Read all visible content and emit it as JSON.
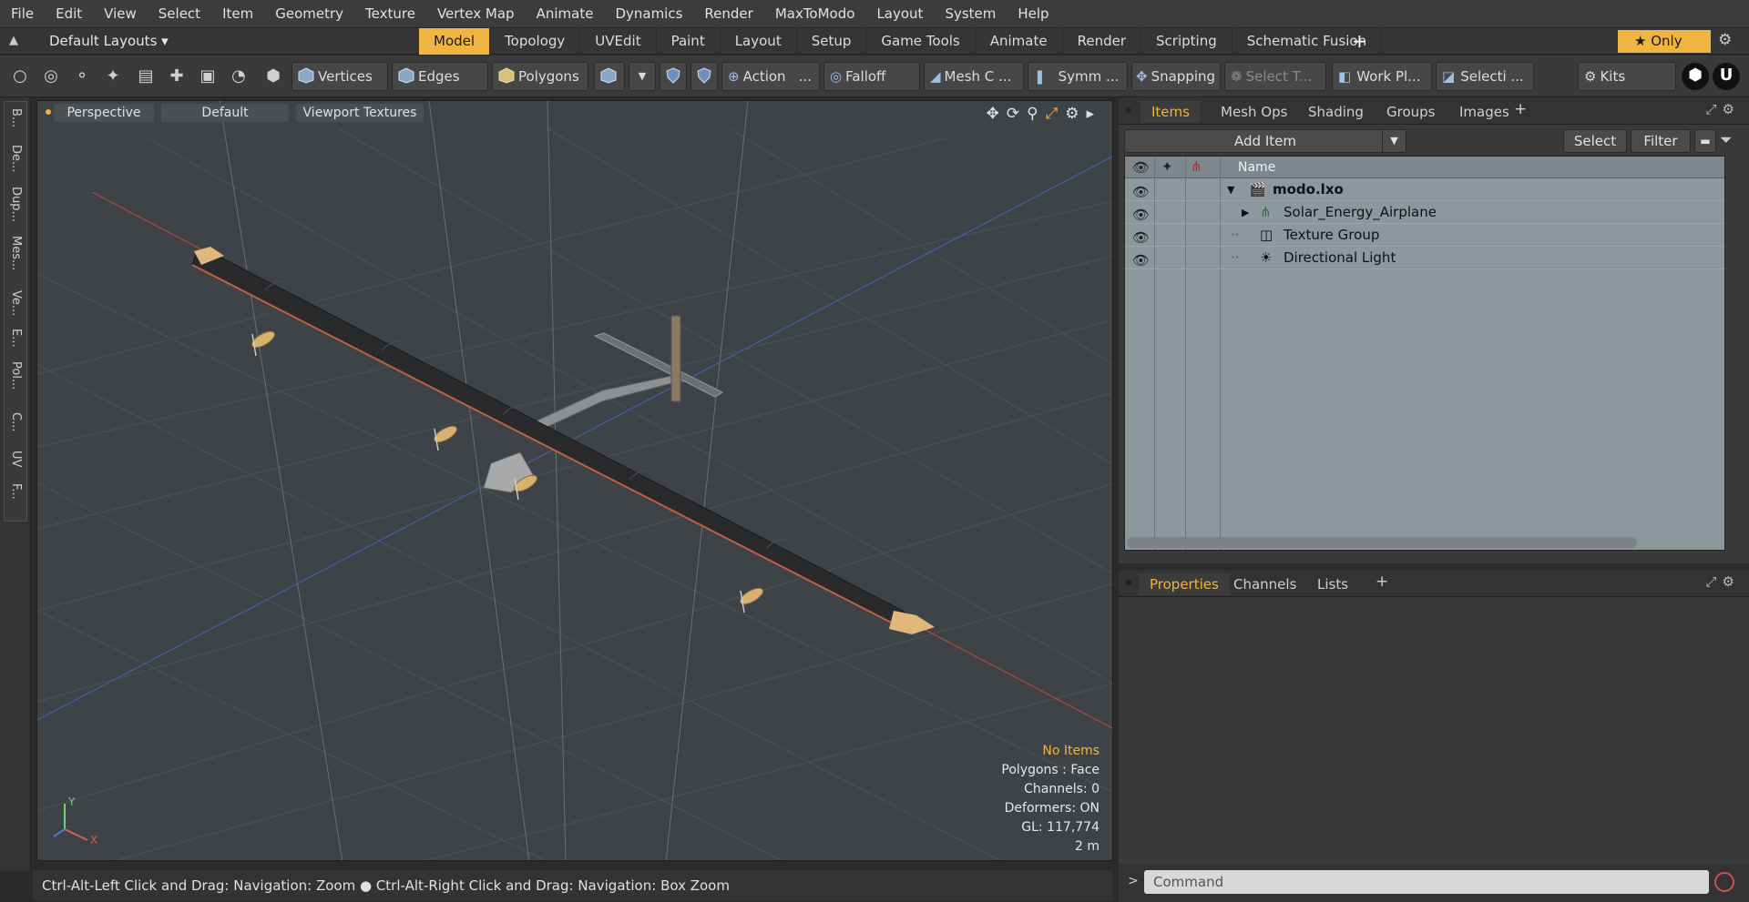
{
  "menu": [
    "File",
    "Edit",
    "View",
    "Select",
    "Item",
    "Geometry",
    "Texture",
    "Vertex Map",
    "Animate",
    "Dynamics",
    "Render",
    "MaxToModo",
    "Layout",
    "System",
    "Help"
  ],
  "layout_selector": "Default Layouts ▾",
  "layout_tabs": [
    "Model",
    "Topology",
    "UVEdit",
    "Paint",
    "Layout",
    "Setup",
    "Game Tools",
    "Animate",
    "Render",
    "Scripting",
    "Schematic Fusion"
  ],
  "active_layout_tab": "Model",
  "only_label": "★  Only",
  "toolbar": {
    "vertices": "Vertices",
    "edges": "Edges",
    "polygons": "Polygons",
    "action": "Action",
    "action_more": "...",
    "falloff": "Falloff",
    "mesh": "Mesh C ...",
    "symmetry": "Symm ...",
    "snapping": "Snapping",
    "select_t": "Select T...",
    "workplane": "Work Pl...",
    "selection": "Selecti ...",
    "kits": "Kits"
  },
  "left_tabs": [
    "B...",
    "De...",
    "Dup...",
    "Mes...",
    "Ve...",
    "E...",
    "Pol...",
    "C...",
    "UV",
    "F..."
  ],
  "viewport": {
    "view_mode": "Perspective",
    "shading": "Default",
    "textures": "Viewport Textures",
    "stats": {
      "selection": "No Items",
      "polygons": "Polygons : Face",
      "channels": "Channels: 0",
      "deformers": "Deformers: ON",
      "gl": "GL: 117,774",
      "scale": "2 m"
    },
    "axis_y": "Y",
    "axis_x": "X"
  },
  "status_hint": "Ctrl-Alt-Left Click and Drag: Navigation: Zoom ● Ctrl-Alt-Right Click and Drag: Navigation: Box Zoom",
  "items_panel": {
    "tabs": [
      "Items",
      "Mesh Ops",
      "Shading",
      "Groups",
      "Images"
    ],
    "active_tab": "Items",
    "add_item": "Add Item",
    "select_btn": "Select",
    "filter_btn": "Filter",
    "name_header": "Name",
    "rows": [
      {
        "label": "modo.lxo",
        "bold": true
      },
      {
        "label": "Solar_Energy_Airplane"
      },
      {
        "label": "Texture Group"
      },
      {
        "label": "Directional Light"
      }
    ]
  },
  "properties_panel": {
    "tabs": [
      "Properties",
      "Channels",
      "Lists"
    ],
    "active_tab": "Properties"
  },
  "command_placeholder": "Command",
  "colors": {
    "accent": "#f0b440",
    "viewport_bg": "#3d4347",
    "wing": "#2a2a2c",
    "wing_edge": "#c06040",
    "wingtip": "#e0b87a",
    "x_axis": "#b04a3a",
    "z_axis": "#4a5aa8"
  }
}
